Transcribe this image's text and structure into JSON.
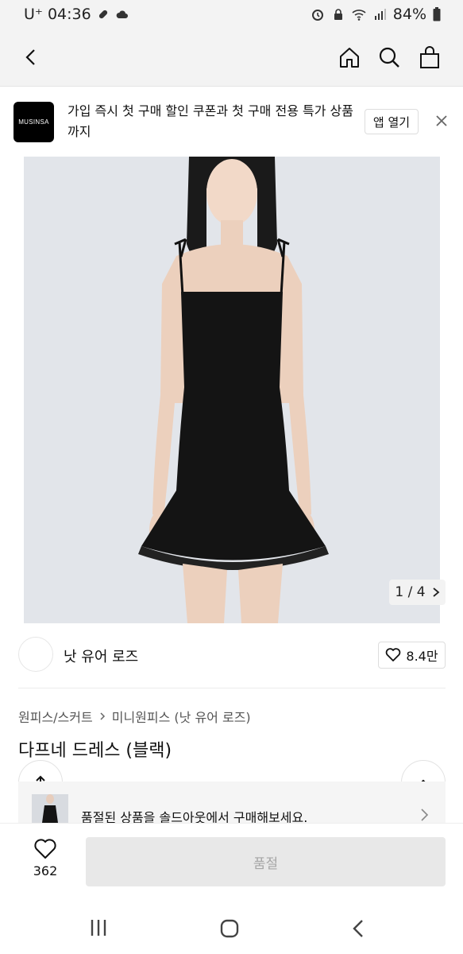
{
  "status_bar": {
    "carrier": "U⁺",
    "time": "04:36",
    "battery": "84%"
  },
  "banner": {
    "logo_text": "MUSINSA",
    "message": "가입 즉시 첫 구매 할인 쿠폰과 첫 구매 전용 특가 상품까지",
    "open_app_label": "앱 열기"
  },
  "gallery": {
    "counter": "1 / 4"
  },
  "brand": {
    "name": "낫 유어 로즈",
    "likes": "8.4만"
  },
  "product": {
    "category_parent": "원피스/스커트",
    "category_child": "미니원피스 (낫 유어 로즈)",
    "title": "다프네 드레스 (블랙)"
  },
  "soldout_notice": {
    "text": "품절된 상품을 솔드아웃에서 구매해보세요."
  },
  "action_bar": {
    "wish_count": "362",
    "buy_label": "품절"
  },
  "colors": {
    "accent_black": "#000000",
    "disabled_bg": "#e8e8e8",
    "disabled_text": "#a6a6a6"
  }
}
